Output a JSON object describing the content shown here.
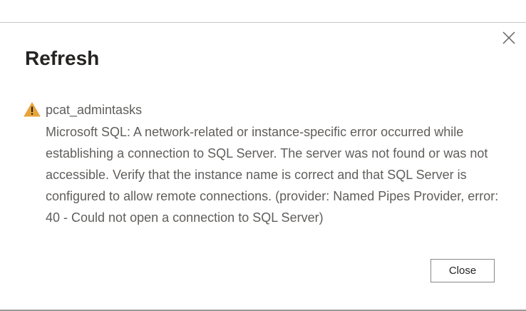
{
  "dialog": {
    "title": "Refresh",
    "close_icon": "close-icon",
    "warning_icon": "warning-triangle-icon",
    "warning_color": "#e8a33a",
    "source_name": "pcat_admintasks",
    "message": "Microsoft SQL: A network-related or instance-specific error occurred while establishing a connection to SQL Server. The server was not found or was not accessible. Verify that the instance name is correct and that SQL Server is configured to allow remote connections. (provider: Named Pipes Provider, error: 40 - Could not open a connection to SQL Server)",
    "close_button_label": "Close"
  }
}
